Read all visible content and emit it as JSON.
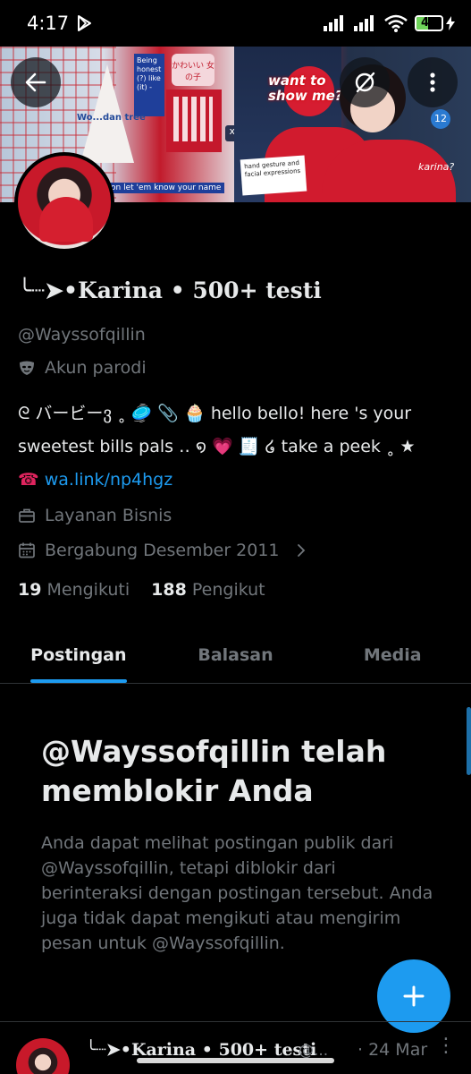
{
  "status_bar": {
    "time": "4:17",
    "battery_level": "46",
    "battery_fraction": 0.46
  },
  "banner": {
    "text_want": "want to",
    "text_show": "show me?",
    "text_being": "Being honest (?) like (it) -",
    "text_karina": "karina?",
    "text_know": "on let 'em know your name",
    "text_hand": "hand gesture and facial expressions",
    "text_jp": "かわいい 女の子",
    "text_12": "12",
    "text_xo": "xo",
    "text_tree": "Wo...dan tree"
  },
  "profile": {
    "display_name": "╰┈➤•Karina • 500+ testi",
    "handle": "@Wayssofqillin",
    "parody_label": "Akun parodi",
    "bio_line1": "ᘓ バービーვ  ˳ 🥏 📎 🧁 hello bello!  here 's your",
    "bio_line2": "sweetest bills pals  ‥ ໑ 💗 🧾 ໒  take a peek ˳ ★",
    "bio_phone": "☎",
    "bio_link": "wa.link/np4hgz",
    "business_label": "Layanan Bisnis",
    "joined_label": "Bergabung Desember 2011"
  },
  "stats": {
    "following_count": "19",
    "following_label": "Mengikuti",
    "followers_count": "188",
    "followers_label": "Pengikut"
  },
  "tabs": [
    {
      "label": "Postingan",
      "active": true
    },
    {
      "label": "Balasan",
      "active": false
    },
    {
      "label": "Media",
      "active": false
    }
  ],
  "blocked": {
    "title": "@Wayssofqillin telah memblokir Anda",
    "body": "Anda dapat melihat postingan publik dari @Wayssofqillin, tetapi diblokir dari berinteraksi dengan postingan tersebut. Anda juga tidak dapat mengikuti atau mengirim pesan untuk @Wayssofqillin."
  },
  "post_preview": {
    "name": "╰┈➤•Karina • 500+ testi",
    "handle": "@...",
    "date": "· 24 Mar",
    "more": "⋮"
  },
  "colors": {
    "accent": "#1d9bf0",
    "background": "#000000",
    "text_primary": "#e7e9ea",
    "text_secondary": "#71767b",
    "battery": "#6fd55a"
  },
  "icons": {
    "back": "arrow-left-icon",
    "no_image": "circle-slash-icon",
    "more": "more-vertical-icon",
    "parody": "mask-icon",
    "business": "briefcase-icon",
    "calendar": "calendar-icon",
    "chevron": "chevron-right-icon",
    "compose": "plus-icon"
  }
}
